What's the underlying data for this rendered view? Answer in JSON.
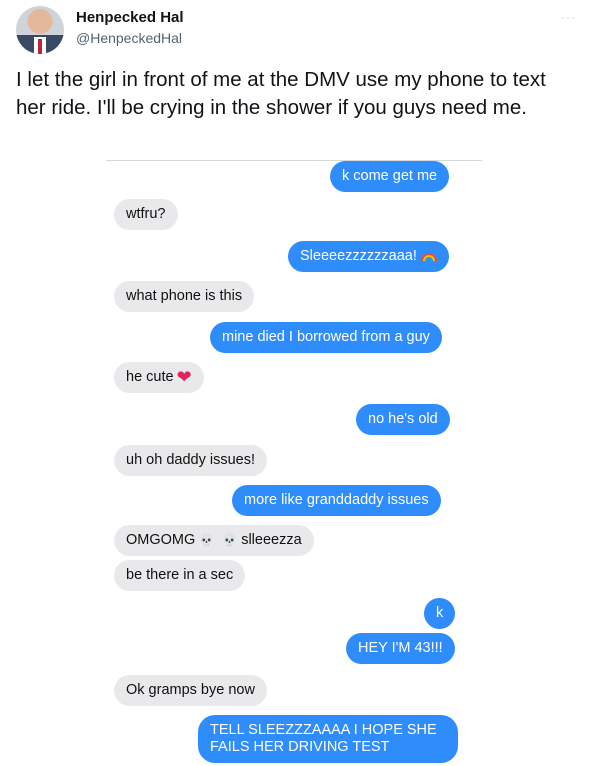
{
  "tweet": {
    "display_name": "Henpecked Hal",
    "handle": "@HenpeckedHal",
    "more": "···",
    "text": "I let the girl in front of me at the DMV use my phone to text her ride. I'll be crying in the shower if you guys need me."
  },
  "conversation": [
    {
      "side": "sent",
      "text": "k come get me"
    },
    {
      "side": "received",
      "text": "wtfru?"
    },
    {
      "side": "sent",
      "text": "Sleeeezzzzzzaaa!",
      "icon": "rainbow-emoji"
    },
    {
      "side": "received",
      "text": "what phone is this"
    },
    {
      "side": "sent",
      "text": "mine died I borrowed from a guy"
    },
    {
      "side": "received",
      "text": "he cute",
      "icon": "red-heart-emoji"
    },
    {
      "side": "sent",
      "text": "no he's old"
    },
    {
      "side": "received",
      "text": "uh oh daddy issues!"
    },
    {
      "side": "sent",
      "text": "more like granddaddy issues"
    },
    {
      "side": "received",
      "text_before": "OMGOMG",
      "text_after": "slleeezza",
      "icon": "skull-emoji"
    },
    {
      "side": "received",
      "text": "be there in a sec"
    },
    {
      "side": "sent",
      "text": "k"
    },
    {
      "side": "sent",
      "text": "HEY I'M 43!!!"
    },
    {
      "side": "received",
      "text": "Ok gramps bye now"
    },
    {
      "side": "sent",
      "text": "TELL SLEEZZZAAAA I HOPE SHE FAILS HER DRIVING TEST"
    }
  ],
  "colors": {
    "sent_bubble": "#2f8cfb",
    "received_bubble": "#e9e9eb",
    "heart": "#e0245e"
  }
}
